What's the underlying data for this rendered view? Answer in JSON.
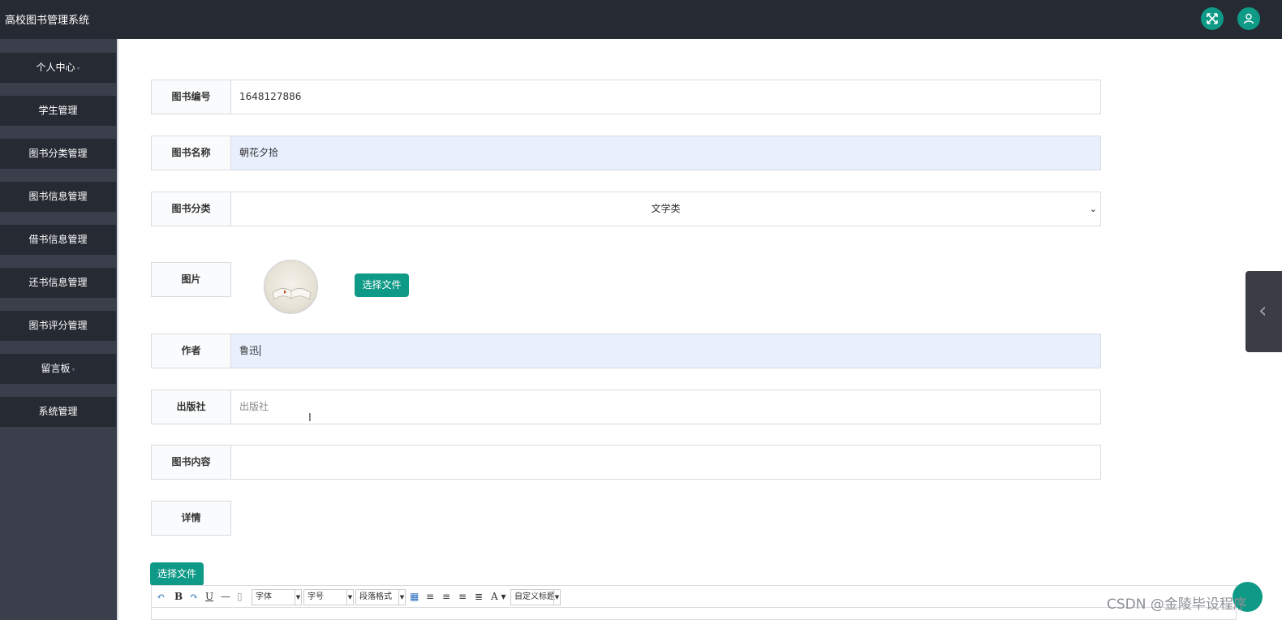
{
  "app": {
    "title": "高校图书管理系统"
  },
  "header": {
    "icons": [
      "fullscreen-icon",
      "user-icon"
    ],
    "accent_color": "#0e9a87",
    "bar_color": "#262a33"
  },
  "sidebar": {
    "items": [
      {
        "label": "个人中心",
        "has_caret": true
      },
      {
        "label": "学生管理",
        "has_caret": false
      },
      {
        "label": "图书分类管理",
        "has_caret": false
      },
      {
        "label": "图书信息管理",
        "has_caret": false
      },
      {
        "label": "借书信息管理",
        "has_caret": false
      },
      {
        "label": "还书信息管理",
        "has_caret": false
      },
      {
        "label": "图书评分管理",
        "has_caret": false
      },
      {
        "label": "留言板",
        "has_caret": true
      },
      {
        "label": "系统管理",
        "has_caret": false
      }
    ],
    "caret": "▾"
  },
  "form": {
    "book_no": {
      "label": "图书编号",
      "value": "1648127886"
    },
    "book_name": {
      "label": "图书名称",
      "value": "朝花夕拾"
    },
    "category": {
      "label": "图书分类",
      "value": "文学类"
    },
    "image": {
      "label": "图片",
      "button": "选择文件"
    },
    "author": {
      "label": "作者",
      "value": "鲁迅"
    },
    "publisher": {
      "label": "出版社",
      "placeholder": "出版社"
    },
    "content": {
      "label": "图书内容",
      "value": ""
    },
    "detail": {
      "label": "详情",
      "button": "选择文件"
    }
  },
  "editor": {
    "toolbar": {
      "bold": "B",
      "underline": "U",
      "font_family": "字体",
      "font_size": "字号",
      "paragraph": "段落格式",
      "font_color": "A",
      "custom_title": "自定义标题"
    }
  },
  "watermark": "CSDN @金陵毕设程序"
}
